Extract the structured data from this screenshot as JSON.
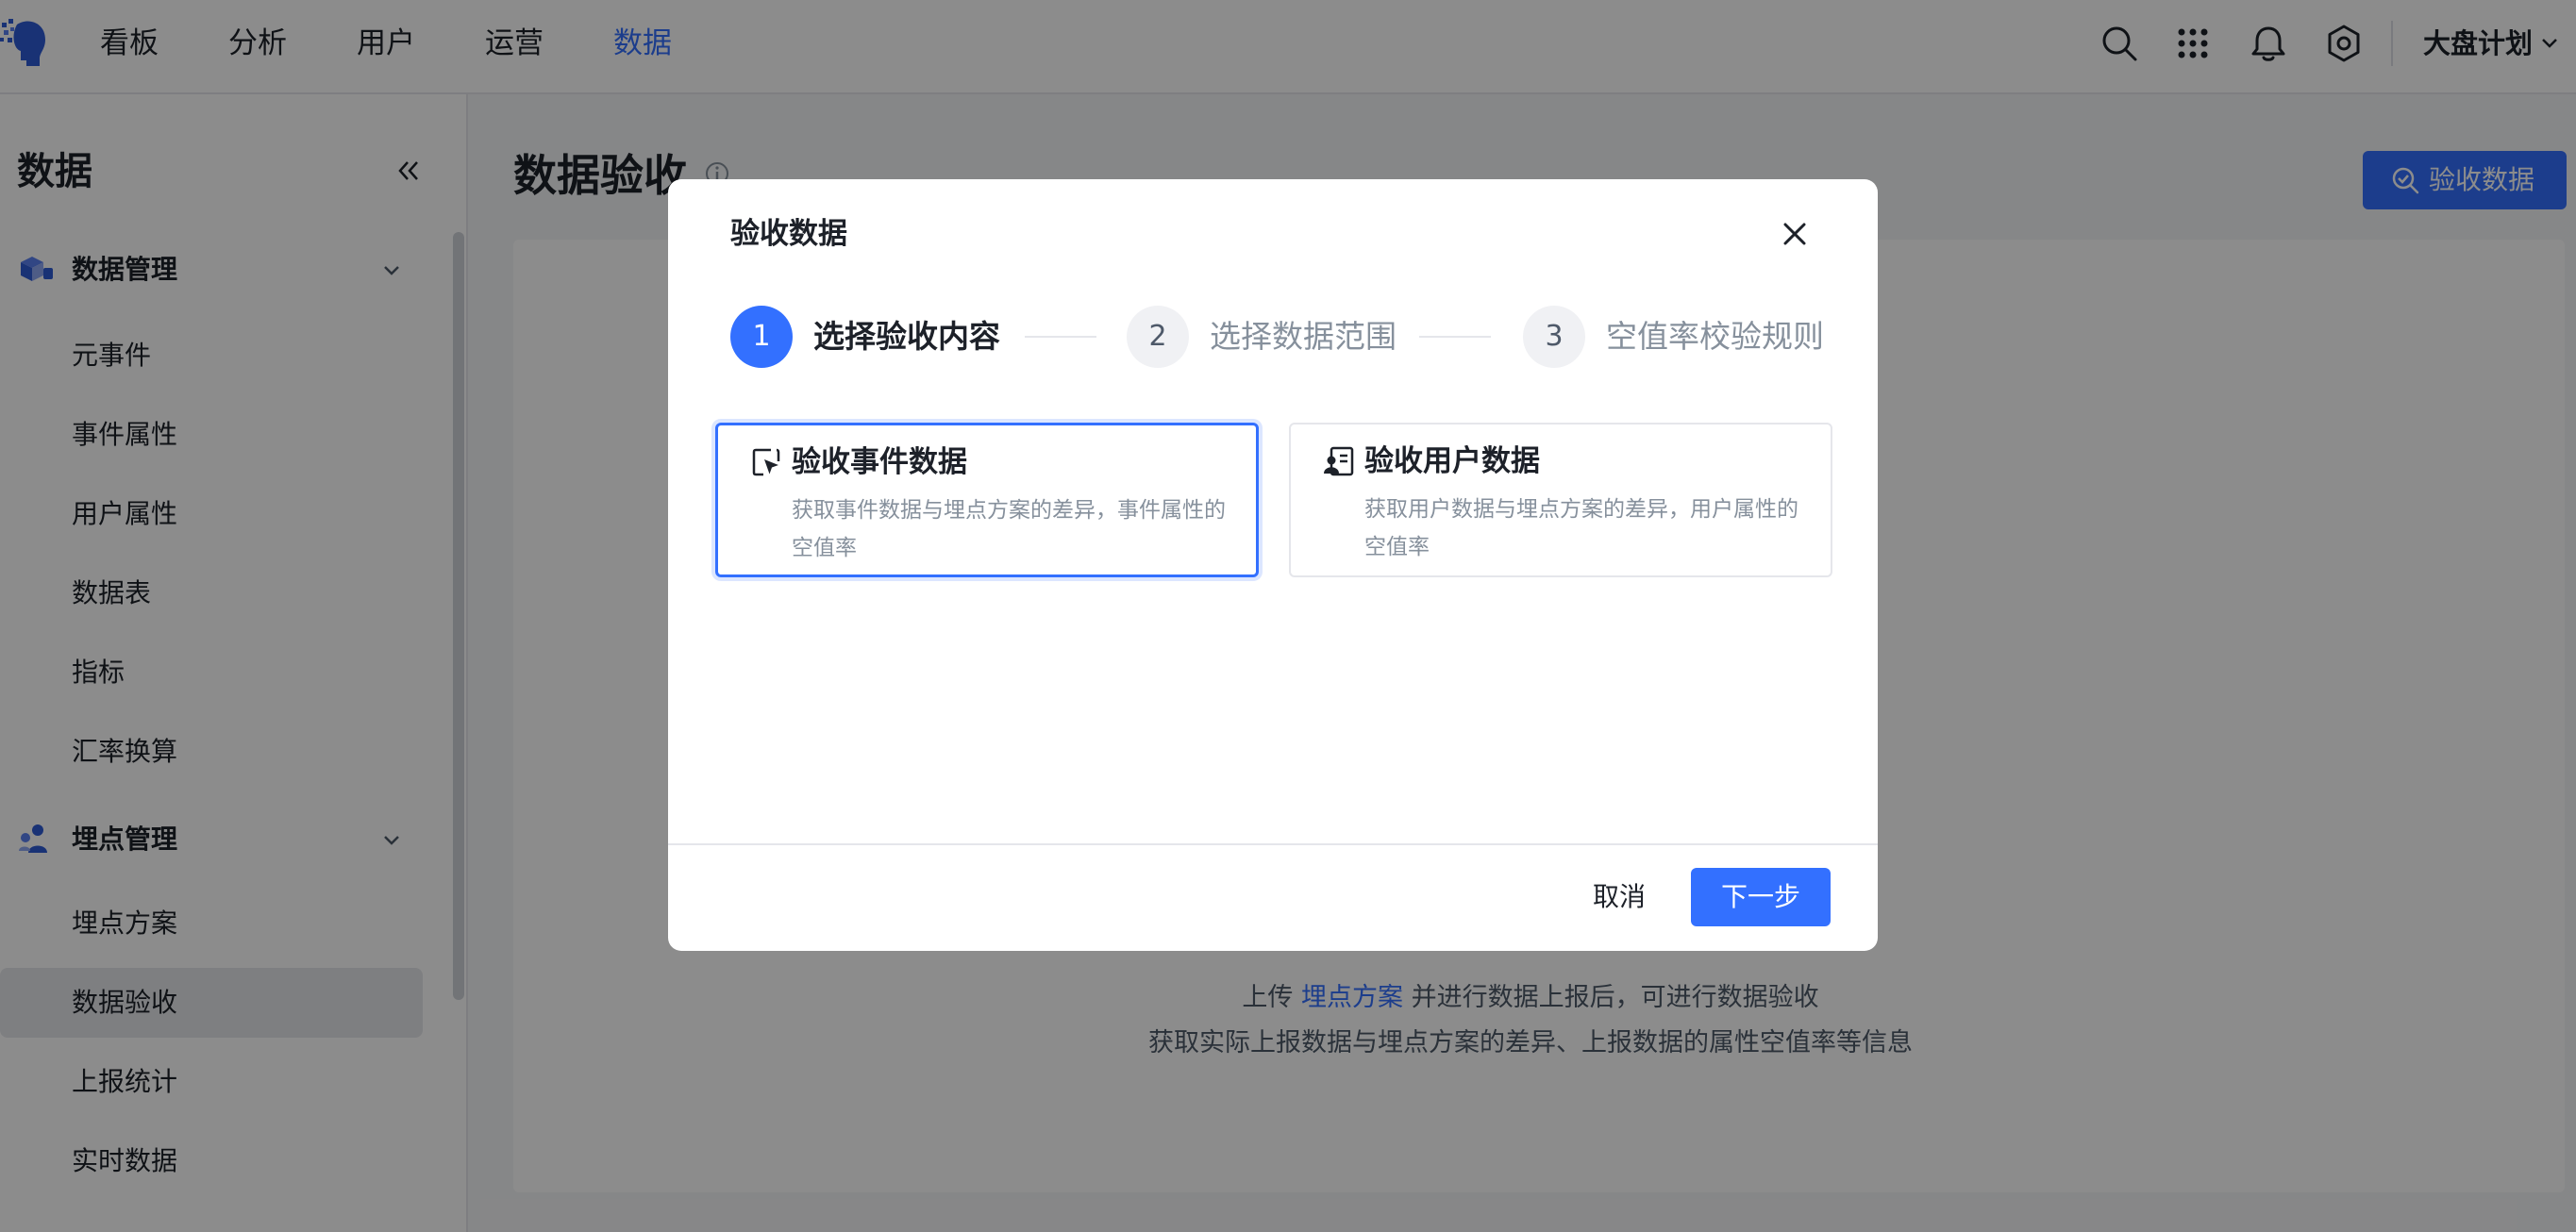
{
  "header": {
    "nav": [
      "看板",
      "分析",
      "用户",
      "运营",
      "数据"
    ],
    "active_nav": "数据",
    "project": "大盘计划",
    "icons": [
      "search-icon",
      "apps-grid-icon",
      "bell-icon",
      "gear-icon"
    ]
  },
  "sidebar": {
    "title": "数据",
    "groups": [
      {
        "label": "数据管理",
        "icon": "cube-icon",
        "items": [
          "元事件",
          "事件属性",
          "用户属性",
          "数据表",
          "指标",
          "汇率换算"
        ]
      },
      {
        "label": "埋点管理",
        "icon": "people-icon",
        "items": [
          "埋点方案",
          "数据验收",
          "上报统计",
          "实时数据"
        ]
      }
    ],
    "active_item": "数据验收"
  },
  "main": {
    "title": "数据验收",
    "action_button": "验收数据",
    "empty": {
      "line1_prefix": "上传",
      "line1_link": "埋点方案",
      "line1_suffix": "并进行数据上报后，可进行数据验收",
      "line2": "获取实际上报数据与埋点方案的差异、上报数据的属性空值率等信息"
    }
  },
  "modal": {
    "title": "验收数据",
    "steps": [
      {
        "num": "1",
        "label": "选择验收内容"
      },
      {
        "num": "2",
        "label": "选择数据范围"
      },
      {
        "num": "3",
        "label": "空值率校验规则"
      }
    ],
    "current_step": 1,
    "options": [
      {
        "title": "验收事件数据",
        "desc": "获取事件数据与埋点方案的差异，事件属性的空值率",
        "icon": "event-cursor-icon",
        "selected": true
      },
      {
        "title": "验收用户数据",
        "desc": "获取用户数据与埋点方案的差异，用户属性的空值率",
        "icon": "user-card-icon",
        "selected": false
      }
    ],
    "cancel": "取消",
    "next": "下一步"
  },
  "colors": {
    "accent": "#3370ff",
    "text": "#1d2129",
    "muted": "#86909c"
  }
}
